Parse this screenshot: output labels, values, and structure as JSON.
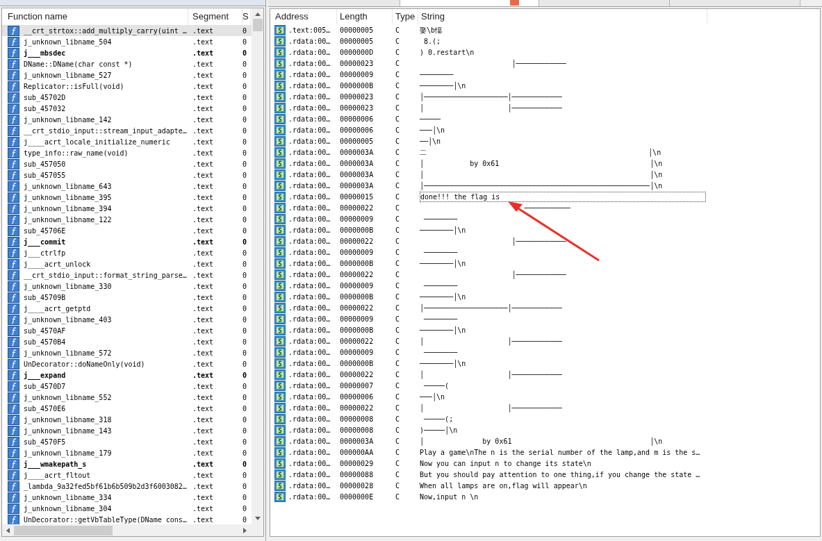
{
  "functions_window": {
    "columns": [
      "Function name",
      "Segment",
      "S"
    ],
    "rows": [
      {
        "name": "__crt_strtox::add_multiply_carry(uint …",
        "segment": ".text",
        "column_3": "0",
        "bold": false,
        "selected": true
      },
      {
        "name": "j_unknown_libname_504",
        "segment": ".text",
        "column_3": "0",
        "bold": false,
        "selected": false
      },
      {
        "name": "j___mbsdec",
        "segment": ".text",
        "column_3": "0",
        "bold": true,
        "selected": false
      },
      {
        "name": "DName::DName(char const *)",
        "segment": ".text",
        "column_3": "0",
        "bold": false,
        "selected": false
      },
      {
        "name": "j_unknown_libname_527",
        "segment": ".text",
        "column_3": "0",
        "bold": false,
        "selected": false
      },
      {
        "name": "Replicator::isFull(void)",
        "segment": ".text",
        "column_3": "0",
        "bold": false,
        "selected": false
      },
      {
        "name": "sub_45702D",
        "segment": ".text",
        "column_3": "0",
        "bold": false,
        "selected": false
      },
      {
        "name": "sub_457032",
        "segment": ".text",
        "column_3": "0",
        "bold": false,
        "selected": false
      },
      {
        "name": "j_unknown_libname_142",
        "segment": ".text",
        "column_3": "0",
        "bold": false,
        "selected": false
      },
      {
        "name": "__crt_stdio_input::stream_input_adapte…",
        "segment": ".text",
        "column_3": "0",
        "bold": false,
        "selected": false
      },
      {
        "name": "j____acrt_locale_initialize_numeric",
        "segment": ".text",
        "column_3": "0",
        "bold": false,
        "selected": false
      },
      {
        "name": "type_info::raw_name(void)",
        "segment": ".text",
        "column_3": "0",
        "bold": false,
        "selected": false
      },
      {
        "name": "sub_457050",
        "segment": ".text",
        "column_3": "0",
        "bold": false,
        "selected": false
      },
      {
        "name": "sub_457055",
        "segment": ".text",
        "column_3": "0",
        "bold": false,
        "selected": false
      },
      {
        "name": "j_unknown_libname_643",
        "segment": ".text",
        "column_3": "0",
        "bold": false,
        "selected": false
      },
      {
        "name": "j_unknown_libname_395",
        "segment": ".text",
        "column_3": "0",
        "bold": false,
        "selected": false
      },
      {
        "name": "j_unknown_libname_394",
        "segment": ".text",
        "column_3": "0",
        "bold": false,
        "selected": false
      },
      {
        "name": "j_unknown_libname_122",
        "segment": ".text",
        "column_3": "0",
        "bold": false,
        "selected": false
      },
      {
        "name": "sub_45706E",
        "segment": ".text",
        "column_3": "0",
        "bold": false,
        "selected": false
      },
      {
        "name": "j___commit",
        "segment": ".text",
        "column_3": "0",
        "bold": true,
        "selected": false
      },
      {
        "name": "j___ctrlfp",
        "segment": ".text",
        "column_3": "0",
        "bold": false,
        "selected": false
      },
      {
        "name": "j____acrt_unlock",
        "segment": ".text",
        "column_3": "0",
        "bold": false,
        "selected": false
      },
      {
        "name": "__crt_stdio_input::format_string_parse…",
        "segment": ".text",
        "column_3": "0",
        "bold": false,
        "selected": false
      },
      {
        "name": "j_unknown_libname_330",
        "segment": ".text",
        "column_3": "0",
        "bold": false,
        "selected": false
      },
      {
        "name": "sub_45709B",
        "segment": ".text",
        "column_3": "0",
        "bold": false,
        "selected": false
      },
      {
        "name": "j____acrt_getptd",
        "segment": ".text",
        "column_3": "0",
        "bold": false,
        "selected": false
      },
      {
        "name": "j_unknown_libname_403",
        "segment": ".text",
        "column_3": "0",
        "bold": false,
        "selected": false
      },
      {
        "name": "sub_4570AF",
        "segment": ".text",
        "column_3": "0",
        "bold": false,
        "selected": false
      },
      {
        "name": "sub_4570B4",
        "segment": ".text",
        "column_3": "0",
        "bold": false,
        "selected": false
      },
      {
        "name": "j_unknown_libname_572",
        "segment": ".text",
        "column_3": "0",
        "bold": false,
        "selected": false
      },
      {
        "name": "UnDecorator::doNameOnly(void)",
        "segment": ".text",
        "column_3": "0",
        "bold": false,
        "selected": false
      },
      {
        "name": "j___expand",
        "segment": ".text",
        "column_3": "0",
        "bold": true,
        "selected": false
      },
      {
        "name": "sub_4570D7",
        "segment": ".text",
        "column_3": "0",
        "bold": false,
        "selected": false
      },
      {
        "name": "j_unknown_libname_552",
        "segment": ".text",
        "column_3": "0",
        "bold": false,
        "selected": false
      },
      {
        "name": "sub_4570E6",
        "segment": ".text",
        "column_3": "0",
        "bold": false,
        "selected": false
      },
      {
        "name": "j_unknown_libname_318",
        "segment": ".text",
        "column_3": "0",
        "bold": false,
        "selected": false
      },
      {
        "name": "j_unknown_libname_143",
        "segment": ".text",
        "column_3": "0",
        "bold": false,
        "selected": false
      },
      {
        "name": "sub_4570F5",
        "segment": ".text",
        "column_3": "0",
        "bold": false,
        "selected": false
      },
      {
        "name": "j_unknown_libname_179",
        "segment": ".text",
        "column_3": "0",
        "bold": false,
        "selected": false
      },
      {
        "name": "j___wmakepath_s",
        "segment": ".text",
        "column_3": "0",
        "bold": true,
        "selected": false
      },
      {
        "name": "j____acrt_fltout",
        "segment": ".text",
        "column_3": "0",
        "bold": false,
        "selected": false
      },
      {
        "name": "_lambda_9a32fed5bf61b6b509b2d3f6003082…",
        "segment": ".text",
        "column_3": "0",
        "bold": false,
        "selected": false
      },
      {
        "name": "j_unknown_libname_334",
        "segment": ".text",
        "column_3": "0",
        "bold": false,
        "selected": false
      },
      {
        "name": "j_unknown_libname_304",
        "segment": ".text",
        "column_3": "0",
        "bold": false,
        "selected": false
      },
      {
        "name": "UnDecorator::getVbTableType(DName cons…",
        "segment": ".text",
        "column_3": "0",
        "bold": false,
        "selected": false
      }
    ]
  },
  "tabs": [
    {
      "selected": false
    },
    {
      "selected": true
    },
    {
      "selected": false
    },
    {
      "selected": false
    }
  ],
  "strings_window": {
    "columns": [
      "Address",
      "Length",
      "Type",
      "String"
    ],
    "rows": [
      {
        "address": ".text:005…",
        "length": "00000005",
        "type": "C",
        "string": "娶\\b愊",
        "selected": false
      },
      {
        "address": ".rdata:00…",
        "length": "00000005",
        "type": "C",
        "string": " 8.(;",
        "selected": false
      },
      {
        "address": ".rdata:00…",
        "length": "0000000D",
        "type": "C",
        "string": ") 0.restart\\n",
        "selected": false
      },
      {
        "address": ".rdata:00…",
        "length": "00000023",
        "type": "C",
        "string": "                      │────────────",
        "selected": false
      },
      {
        "address": ".rdata:00…",
        "length": "00000009",
        "type": "C",
        "string": "────────",
        "selected": false
      },
      {
        "address": ".rdata:00…",
        "length": "0000000B",
        "type": "C",
        "string": "────────│\\n",
        "selected": false
      },
      {
        "address": ".rdata:00…",
        "length": "00000023",
        "type": "C",
        "string": "│────────────────────│────────────",
        "selected": false
      },
      {
        "address": ".rdata:00…",
        "length": "00000023",
        "type": "C",
        "string": "│                    │────────────",
        "selected": false
      },
      {
        "address": ".rdata:00…",
        "length": "00000006",
        "type": "C",
        "string": "─────",
        "selected": false
      },
      {
        "address": ".rdata:00…",
        "length": "00000006",
        "type": "C",
        "string": "───│\\n",
        "selected": false
      },
      {
        "address": ".rdata:00…",
        "length": "00000005",
        "type": "C",
        "string": "──│\\n",
        "selected": false
      },
      {
        "address": ".rdata:00…",
        "length": "0000003A",
        "type": "C",
        "string": "二                                                     │\\n",
        "selected": false
      },
      {
        "address": ".rdata:00…",
        "length": "0000003A",
        "type": "C",
        "string": "│           by 0x61                                    │\\n",
        "selected": false
      },
      {
        "address": ".rdata:00…",
        "length": "0000003A",
        "type": "C",
        "string": "│                                                      │\\n",
        "selected": false
      },
      {
        "address": ".rdata:00…",
        "length": "0000003A",
        "type": "C",
        "string": "│──────────────────────────────────────────────────────│\\n",
        "selected": false
      },
      {
        "address": ".rdata:00…",
        "length": "00000015",
        "type": "C",
        "string": "done!!! the flag is",
        "selected": true
      },
      {
        "address": ".rdata:00…",
        "length": "00000022",
        "type": "C",
        "string": "                         ───────────",
        "selected": false
      },
      {
        "address": ".rdata:00…",
        "length": "00000009",
        "type": "C",
        "string": " ────────",
        "selected": false
      },
      {
        "address": ".rdata:00…",
        "length": "0000000B",
        "type": "C",
        "string": "────────│\\n",
        "selected": false
      },
      {
        "address": ".rdata:00…",
        "length": "00000022",
        "type": "C",
        "string": "                      │────────────",
        "selected": false
      },
      {
        "address": ".rdata:00…",
        "length": "00000009",
        "type": "C",
        "string": " ────────",
        "selected": false
      },
      {
        "address": ".rdata:00…",
        "length": "0000000B",
        "type": "C",
        "string": "────────│\\n",
        "selected": false
      },
      {
        "address": ".rdata:00…",
        "length": "00000022",
        "type": "C",
        "string": "                      │────────────",
        "selected": false
      },
      {
        "address": ".rdata:00…",
        "length": "00000009",
        "type": "C",
        "string": " ────────",
        "selected": false
      },
      {
        "address": ".rdata:00…",
        "length": "0000000B",
        "type": "C",
        "string": "────────│\\n",
        "selected": false
      },
      {
        "address": ".rdata:00…",
        "length": "00000022",
        "type": "C",
        "string": "│────────────────────│────────────",
        "selected": false
      },
      {
        "address": ".rdata:00…",
        "length": "00000009",
        "type": "C",
        "string": " ────────",
        "selected": false
      },
      {
        "address": ".rdata:00…",
        "length": "0000000B",
        "type": "C",
        "string": "────────│\\n",
        "selected": false
      },
      {
        "address": ".rdata:00…",
        "length": "00000022",
        "type": "C",
        "string": "│                    │────────────",
        "selected": false
      },
      {
        "address": ".rdata:00…",
        "length": "00000009",
        "type": "C",
        "string": " ────────",
        "selected": false
      },
      {
        "address": ".rdata:00…",
        "length": "0000000B",
        "type": "C",
        "string": "────────│\\n",
        "selected": false
      },
      {
        "address": ".rdata:00…",
        "length": "00000022",
        "type": "C",
        "string": "│                    │────────────",
        "selected": false
      },
      {
        "address": ".rdata:00…",
        "length": "00000007",
        "type": "C",
        "string": " ─────(",
        "selected": false
      },
      {
        "address": ".rdata:00…",
        "length": "00000006",
        "type": "C",
        "string": "───│\\n",
        "selected": false
      },
      {
        "address": ".rdata:00…",
        "length": "00000022",
        "type": "C",
        "string": "│                    │────────────",
        "selected": false
      },
      {
        "address": ".rdata:00…",
        "length": "00000008",
        "type": "C",
        "string": " ─────(;",
        "selected": false
      },
      {
        "address": ".rdata:00…",
        "length": "00000008",
        "type": "C",
        "string": ")─────│\\n",
        "selected": false
      },
      {
        "address": ".rdata:00…",
        "length": "0000003A",
        "type": "C",
        "string": "│              by 0x61                                 │\\n",
        "selected": false
      },
      {
        "address": ".rdata:00…",
        "length": "000000AA",
        "type": "C",
        "string": "Play a game\\nThe n is the serial number of the lamp,and m is the s…",
        "selected": false
      },
      {
        "address": ".rdata:00…",
        "length": "00000029",
        "type": "C",
        "string": "Now you can input n to change its state\\n",
        "selected": false
      },
      {
        "address": ".rdata:00…",
        "length": "00000088",
        "type": "C",
        "string": "But you should pay attention to one thing,if you change the state …",
        "selected": false
      },
      {
        "address": ".rdata:00…",
        "length": "00000028",
        "type": "C",
        "string": "When all lamps are on,flag will appear\\n",
        "selected": false
      },
      {
        "address": ".rdata:00…",
        "length": "0000000E",
        "type": "C",
        "string": "Now,input n \\n",
        "selected": false
      }
    ]
  }
}
